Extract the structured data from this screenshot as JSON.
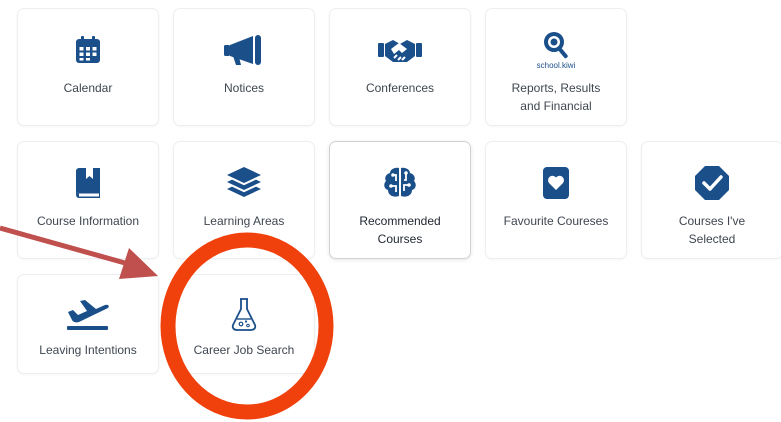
{
  "tiles": {
    "calendar": "Calendar",
    "notices": "Notices",
    "conferences": "Conferences",
    "reports_line1": "Reports, Results",
    "reports_line2": "and Financial",
    "reports_brand": "school.kiwi",
    "course_information": "Course Information",
    "learning_areas": "Learning Areas",
    "recommended_line1": "Recommended",
    "recommended_line2": "Courses",
    "favourite_courses": "Favourite Coureses",
    "selected_line1": "Courses I've",
    "selected_line2": "Selected",
    "leaving_intentions": "Leaving Intentions",
    "career_job_search": "Career Job Search"
  },
  "selected_tile": "recommended-courses",
  "icons": {
    "calendar": "calendar-icon",
    "notices": "megaphone-icon",
    "conferences": "handshake-icon",
    "reports": "magnifier-logo-icon",
    "course_information": "book-icon",
    "learning_areas": "layers-icon",
    "recommended_courses": "brain-circuit-icon",
    "favourite_courses": "heart-card-icon",
    "courses_selected": "check-badge-icon",
    "leaving_intentions": "plane-departure-icon",
    "career_job_search": "flask-icon"
  },
  "annotations": {
    "arrow": "red-arrow",
    "highlight": "orange-circle"
  },
  "colors": {
    "icon_blue": "#1a4f8a",
    "arrow_red": "#c0504d",
    "circle_orange": "#f0400c",
    "border": "#eceef1",
    "label": "#3f4650"
  }
}
